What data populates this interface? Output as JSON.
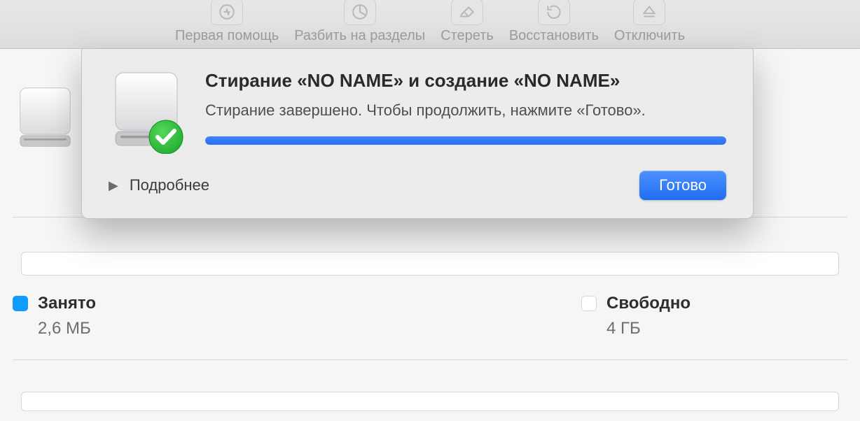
{
  "toolbar": {
    "items": [
      {
        "label": "Первая помощь"
      },
      {
        "label": "Разбить на разделы"
      },
      {
        "label": "Стереть"
      },
      {
        "label": "Восстановить"
      },
      {
        "label": "Отключить"
      }
    ]
  },
  "sheet": {
    "title": "Стирание «NO NAME» и создание «NO NAME»",
    "message": "Стирание завершено. Чтобы продолжить, нажмите «Готово».",
    "details_label": "Подробнее",
    "done_label": "Готово",
    "progress_percent": 100
  },
  "usage": {
    "used_label": "Занято",
    "used_value": "2,6 МБ",
    "free_label": "Свободно",
    "free_value": "4 ГБ"
  }
}
